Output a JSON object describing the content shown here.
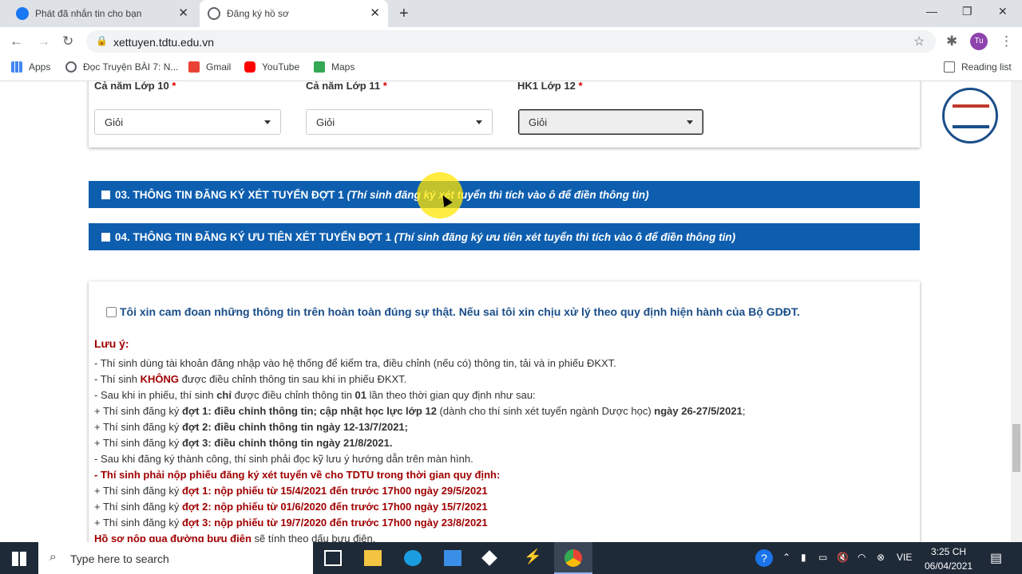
{
  "browser": {
    "tabs": [
      {
        "title": "Phát đã nhắn tin cho bạn",
        "icon": "facebook-icon",
        "color": "#1877f2"
      },
      {
        "title": "Đăng ký hồ sơ",
        "icon": "globe-icon",
        "color": "#5f6368"
      }
    ],
    "url": "xettuyen.tdtu.edu.vn",
    "profile_initials": "Tu",
    "bookmarks": [
      {
        "label": "Apps",
        "icon": "apps-grid-icon"
      },
      {
        "label": "Đọc Truyện BÀI 7: N...",
        "icon": "globe-icon"
      },
      {
        "label": "Gmail",
        "icon": "gmail-icon"
      },
      {
        "label": "YouTube",
        "icon": "youtube-icon"
      },
      {
        "label": "Maps",
        "icon": "maps-icon"
      }
    ],
    "reading_list": "Reading list"
  },
  "form": {
    "grades": [
      {
        "label": "Cả năm Lớp 10",
        "value": "Giỏi"
      },
      {
        "label": "Cả năm Lớp 11",
        "value": "Giỏi"
      },
      {
        "label": "HK1 Lớp 12",
        "value": "Giỏi"
      }
    ],
    "required_mark": "*",
    "section3": {
      "title": "03. THÔNG TIN ĐĂNG KÝ XÉT TUYỂN ĐỢT 1",
      "hint": "(Thí sinh đăng ký xét tuyển thì tích vào ô để điền thông tin)"
    },
    "section4": {
      "title": "04. THÔNG TIN ĐĂNG KÝ ƯU TIÊN XÉT TUYỂN ĐỢT 1",
      "hint": "(Thí sinh đăng ký ưu tiên xét tuyển thì tích vào ô để điền thông tin)"
    },
    "pledge": "Tôi xin cam đoan những thông tin trên hoàn toàn đúng sự thật. Nếu sai tôi xin chịu xử lý theo quy định hiện hành của Bộ GDĐT.",
    "note_title": "Lưu ý:",
    "notes": {
      "n1": "- Thí sinh dùng tài khoản đăng nhập vào hệ thống để kiểm tra, điều chỉnh (nếu có) thông tin, tải và in phiếu ĐKXT.",
      "n2a": "- Thí sinh ",
      "n2b": "KHÔNG",
      "n2c": " được điều chỉnh thông tin sau khi in phiếu ĐKXT.",
      "n3a": "- Sau khi in phiếu, thí sinh ",
      "n3b": "chỉ",
      "n3c": " được điều chỉnh thông tin ",
      "n3d": "01",
      "n3e": " lần theo thời gian quy định như sau:",
      "n4a": " + Thí sinh đăng ký ",
      "n4b": "đợt 1: điều chỉnh thông tin; cập nhật học lực lớp 12",
      "n4c": " (dành cho thí sinh xét tuyển ngành Dược học) ",
      "n4d": "ngày 26-27/5/2021",
      "n4e": ";",
      "n5a": " + Thí sinh đăng ký ",
      "n5b": "đợt 2: điều chỉnh thông tin ngày 12-13/7/2021;",
      "n6a": " + Thí sinh đăng ký ",
      "n6b": "đợt 3: điều chỉnh thông tin ngày 21/8/2021.",
      "n7": "- Sau khi đăng ký thành công, thí sinh phải đọc kỹ lưu ý hướng dẫn trên màn hình.",
      "n8": "- Thí sinh phải nộp phiếu đăng ký xét tuyển về cho TDTU trong thời gian quy định:",
      "n9a": " + Thí sinh đăng ký ",
      "n9b": "đợt 1: nộp phiếu từ 15/4/2021 đến trước 17h00 ngày 29/5/2021",
      "n10a": " + Thí sinh đăng ký ",
      "n10b": "đợt 2: nộp phiếu từ 01/6/2020 đến trước 17h00 ngày 15/7/2021",
      "n11a": " + Thí sinh đăng ký ",
      "n11b": "đợt 3: nộp phiếu từ 19/7/2020 đến trước 17h00 ngày 23/8/2021",
      "n12a": "Hồ sơ nộp qua đường bưu điện",
      "n12b": " sẽ tính theo dấu bưu điện."
    }
  },
  "taskbar": {
    "search_placeholder": "Type here to search",
    "language": "VIE",
    "time": "3:25 CH",
    "date": "06/04/2021"
  }
}
